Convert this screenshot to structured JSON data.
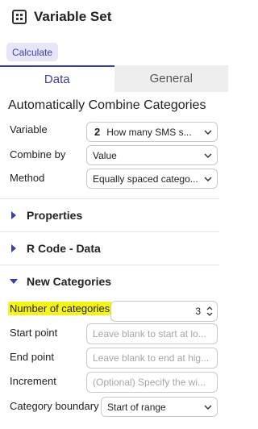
{
  "header": {
    "title": "Variable Set",
    "icon": "grid-icon"
  },
  "calculate_button": "Calculate",
  "tabs": [
    {
      "label": "Data",
      "active": true
    },
    {
      "label": "General",
      "active": false
    }
  ],
  "section_title": "Automatically Combine Categories",
  "fields": {
    "variable": {
      "label": "Variable",
      "number": "2",
      "value": "How many SMS s..."
    },
    "combine_by": {
      "label": "Combine by",
      "value": "Value"
    },
    "method": {
      "label": "Method",
      "value": "Equally spaced catego..."
    }
  },
  "collapsibles": {
    "properties": {
      "label": "Properties",
      "expanded": false
    },
    "rcode": {
      "label": "R Code - Data",
      "expanded": false
    },
    "new_categories": {
      "label": "New Categories",
      "expanded": true
    }
  },
  "new_categories": {
    "number_of_categories": {
      "label": "Number of categories",
      "value": "3",
      "highlighted": true
    },
    "start_point": {
      "label": "Start point",
      "placeholder": "Leave blank to start at lo..."
    },
    "end_point": {
      "label": "End point",
      "placeholder": "Leave blank to end at hig..."
    },
    "increment": {
      "label": "Increment",
      "placeholder": "(Optional) Specify the wi..."
    },
    "category_boundary": {
      "label": "Category boundary",
      "value": "Start of range"
    }
  },
  "colors": {
    "accent": "#3a3fa8",
    "highlight": "#f6f31a",
    "calc_bg": "#e7e6f8"
  }
}
